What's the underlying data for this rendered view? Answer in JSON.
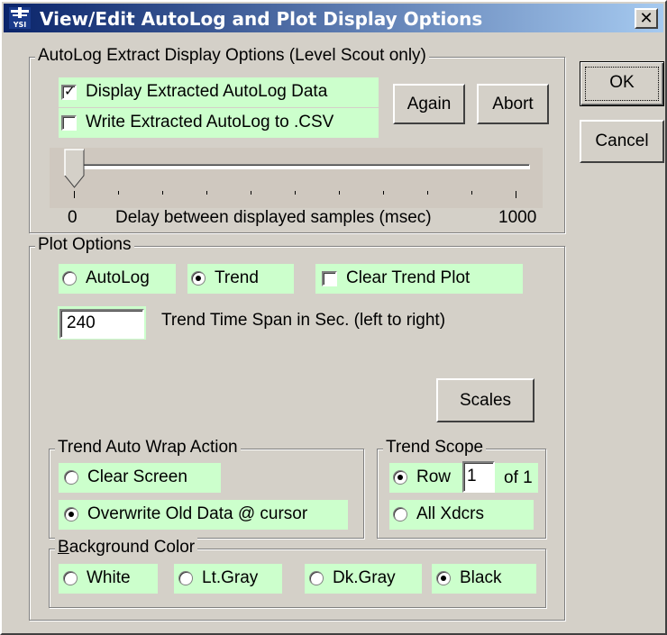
{
  "window": {
    "title": "View/Edit AutoLog and Plot Display Options",
    "close_glyph": "✕",
    "icon_text": "YSI"
  },
  "autolog": {
    "group_title": "AutoLog Extract Display Options (Level Scout only)",
    "display_extracted": {
      "label": "Display Extracted AutoLog Data",
      "checked": true
    },
    "write_csv": {
      "label": "Write Extracted AutoLog to .CSV",
      "checked": false
    },
    "again_label": "Again",
    "abort_label": "Abort",
    "slider": {
      "min_label": "0",
      "max_label": "1000",
      "caption": "Delay between displayed samples (msec)",
      "value": 0
    }
  },
  "buttons": {
    "ok_label": "OK",
    "cancel_label": "Cancel",
    "scales_label": "Scales"
  },
  "plot": {
    "group_title": "Plot Options",
    "autolog_label": "AutoLog",
    "trend_label": "Trend",
    "clear_trend_label": "Clear Trend Plot",
    "mode_selected": "Trend",
    "clear_trend_checked": false,
    "time_span_value": "240",
    "time_span_label": "Trend Time Span in Sec. (left to right)"
  },
  "wrap": {
    "group_title": "Trend Auto Wrap Action",
    "clear_label": "Clear Screen",
    "overwrite_label": "Overwrite Old Data @ cursor",
    "selected": "overwrite"
  },
  "scope": {
    "group_title": "Trend Scope",
    "row_label": "Row",
    "row_value": "1",
    "of_label": "of 1",
    "all_label": "All Xdcrs",
    "selected": "row"
  },
  "background": {
    "group_title_first": "B",
    "group_title_rest": "ackground Color",
    "white": "White",
    "ltgray": "Lt.Gray",
    "dkgray": "Dk.Gray",
    "black": "Black",
    "selected": "black"
  }
}
